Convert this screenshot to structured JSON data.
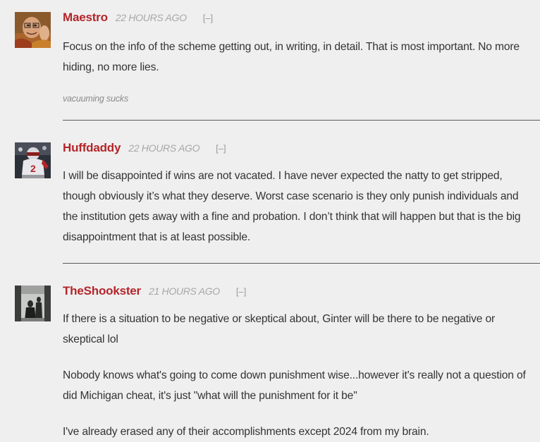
{
  "comments": [
    {
      "author": "Maestro",
      "time": "22 HOURS AGO",
      "collapse": "[–]",
      "paragraphs": [
        "Focus on the info of the scheme getting out, in writing, in detail.  That is most important.  No more hiding, no more lies."
      ],
      "signature": "vacuuming sucks"
    },
    {
      "author": "Huffdaddy",
      "time": "22 HOURS AGO",
      "collapse": "[–]",
      "paragraphs": [
        "I will be disappointed if wins are not vacated. I have never expected the natty to get stripped, though obviously it’s what they deserve. Worst case scenario is they only punish individuals and the institution gets away with a fine and probation. I don’t think that will happen but that is the big disappointment that is at least possible."
      ]
    },
    {
      "author": "TheShookster",
      "time": "21 HOURS AGO",
      "collapse": "[–]",
      "paragraphs": [
        "If there is a situation to be negative or skeptical about, Ginter will be there to be negative or skeptical lol",
        "Nobody knows what's going to come down punishment wise...however it's really not a question of did Michigan cheat, it's just \"what will the punishment for it be\"",
        "I've already erased any of their accomplishments except 2024 from my brain."
      ]
    }
  ]
}
